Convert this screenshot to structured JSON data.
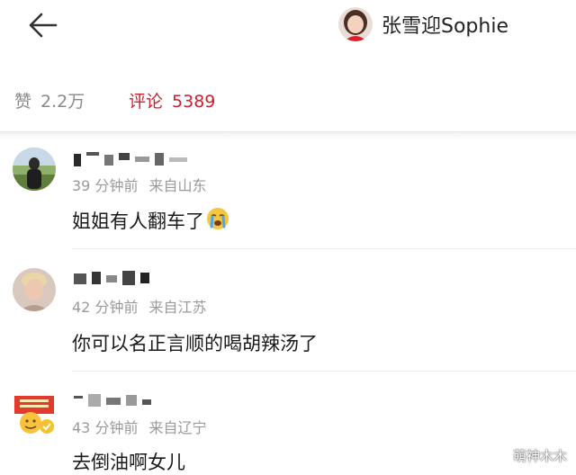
{
  "header": {
    "back_icon": "arrow-left-icon",
    "profile_name": "张雪迎Sophie"
  },
  "tabs": {
    "likes_label": "赞",
    "likes_count": "2.2万",
    "comments_label": "评论",
    "comments_count": "5389"
  },
  "comments": [
    {
      "time": "39 分钟前",
      "location": "来自山东",
      "text": "姐姐有人翻车了",
      "emoji": "crying-face-icon"
    },
    {
      "time": "42 分钟前",
      "location": "来自江苏",
      "text": "你可以名正言顺的喝胡辣汤了"
    },
    {
      "time": "43 分钟前",
      "location": "来自辽宁",
      "text": "去倒油啊女儿"
    }
  ],
  "watermark": "萌神木木",
  "colors": {
    "accent": "#cc1f2f",
    "muted": "#9a9a9a"
  }
}
